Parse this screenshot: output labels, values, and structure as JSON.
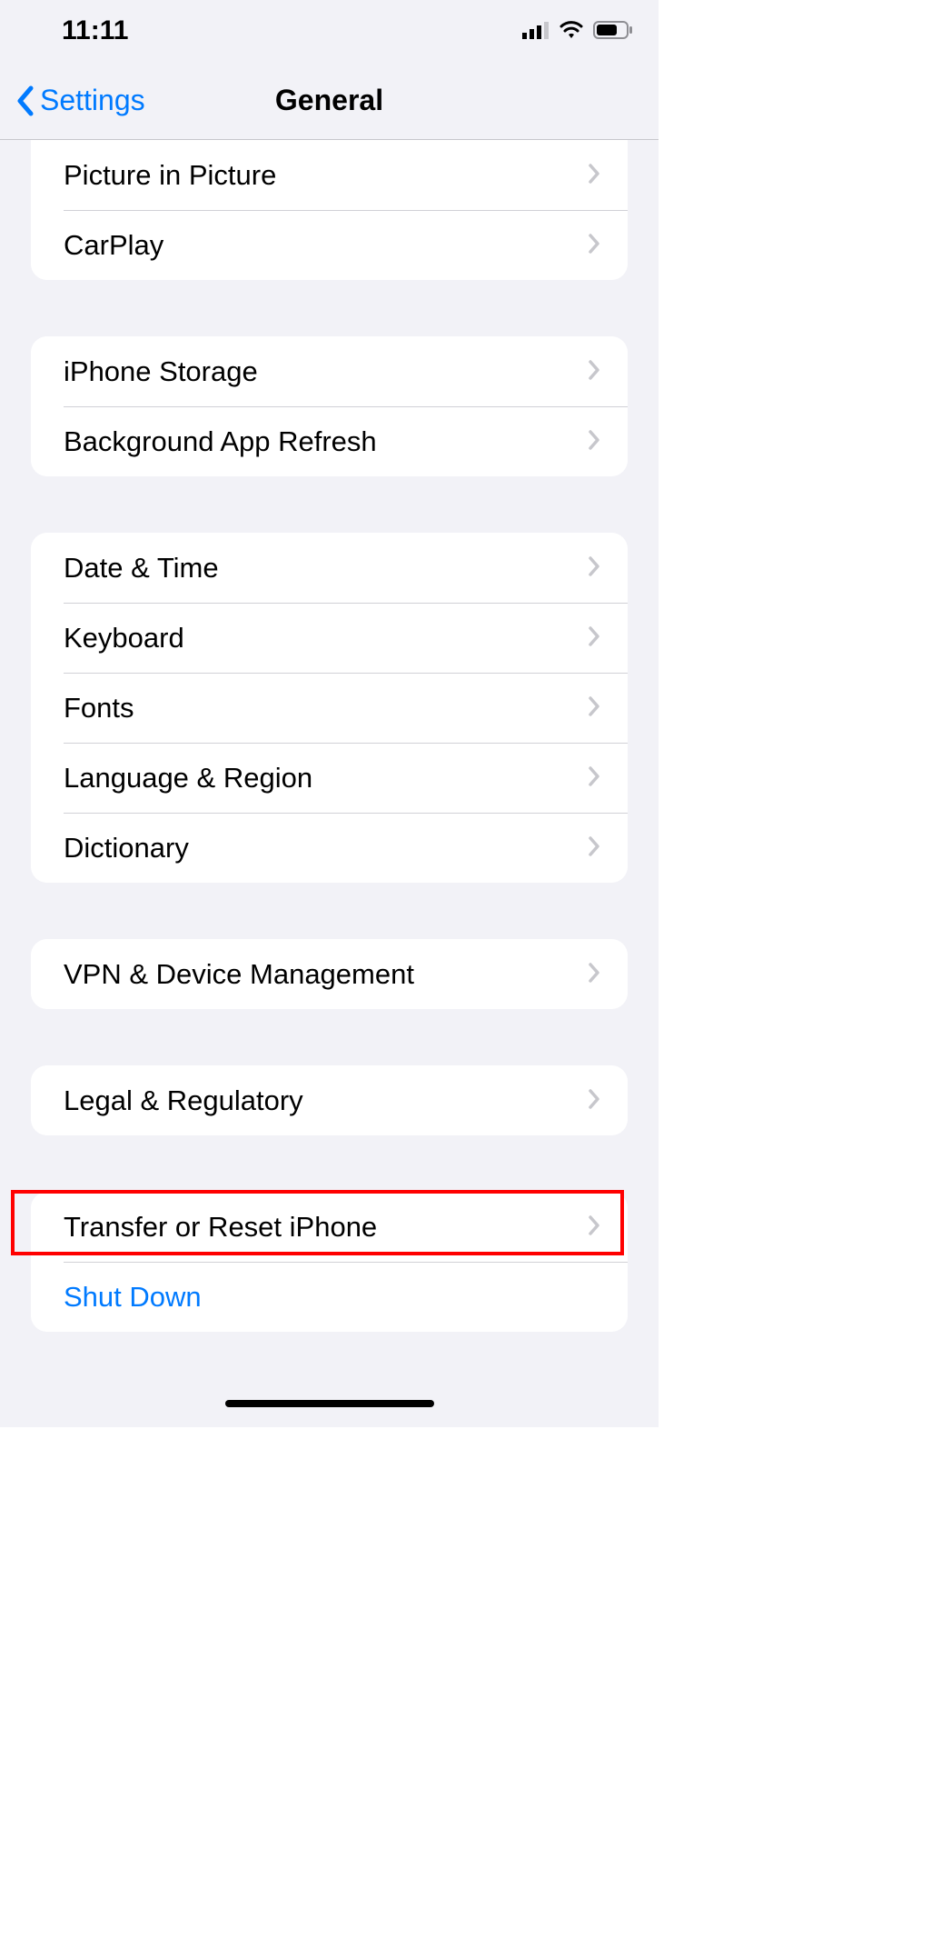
{
  "status": {
    "time": "11:11"
  },
  "nav": {
    "back_label": "Settings",
    "title": "General"
  },
  "groups": [
    {
      "rows": [
        {
          "key": "pip",
          "label": "Picture in Picture",
          "chevron": true
        },
        {
          "key": "carplay",
          "label": "CarPlay",
          "chevron": true
        }
      ]
    },
    {
      "rows": [
        {
          "key": "storage",
          "label": "iPhone Storage",
          "chevron": true
        },
        {
          "key": "bgrefresh",
          "label": "Background App Refresh",
          "chevron": true
        }
      ]
    },
    {
      "rows": [
        {
          "key": "datetime",
          "label": "Date & Time",
          "chevron": true
        },
        {
          "key": "keyboard",
          "label": "Keyboard",
          "chevron": true
        },
        {
          "key": "fonts",
          "label": "Fonts",
          "chevron": true
        },
        {
          "key": "lang",
          "label": "Language & Region",
          "chevron": true
        },
        {
          "key": "dictionary",
          "label": "Dictionary",
          "chevron": true
        }
      ]
    },
    {
      "rows": [
        {
          "key": "vpn",
          "label": "VPN & Device Management",
          "chevron": true
        }
      ]
    },
    {
      "rows": [
        {
          "key": "legal",
          "label": "Legal & Regulatory",
          "chevron": true
        }
      ]
    },
    {
      "rows": [
        {
          "key": "reset",
          "label": "Transfer or Reset iPhone",
          "chevron": true,
          "highlight": true
        },
        {
          "key": "shutdown",
          "label": "Shut Down",
          "chevron": false,
          "action": true
        }
      ]
    }
  ],
  "colors": {
    "accent": "#007aff",
    "highlight": "#ff0000",
    "bg": "#f2f2f7"
  }
}
